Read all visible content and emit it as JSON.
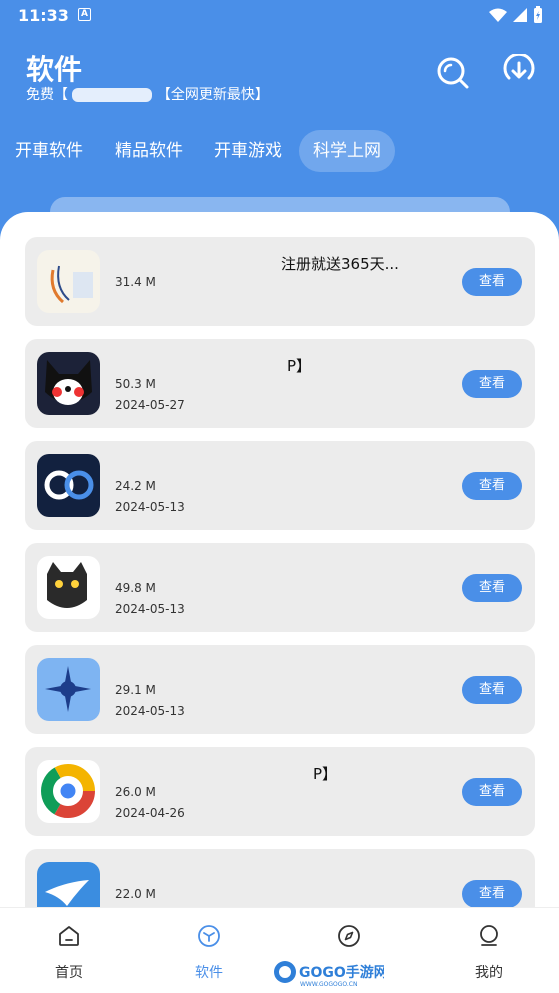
{
  "status": {
    "time": "11:33"
  },
  "header": {
    "title": "软件",
    "subtitle_prefix": "免费【",
    "subtitle_suffix": "【全网更新最快】"
  },
  "tabs": [
    {
      "label": "开車软件",
      "active": false
    },
    {
      "label": "精品软件",
      "active": false
    },
    {
      "label": "开車游戏",
      "active": false
    },
    {
      "label": "科学上网",
      "active": true
    }
  ],
  "view_label": "查看",
  "apps": [
    {
      "name": "注册就送365天...",
      "size": "31.4 M",
      "date": ""
    },
    {
      "name": "P】",
      "size": "50.3 M",
      "date": "2024-05-27"
    },
    {
      "name": "",
      "size": "24.2 M",
      "date": "2024-05-13"
    },
    {
      "name": "",
      "size": "49.8 M",
      "date": "2024-05-13"
    },
    {
      "name": "",
      "size": "29.1 M",
      "date": "2024-05-13"
    },
    {
      "name": "P】",
      "size": "26.0 M",
      "date": "2024-04-26"
    },
    {
      "name": "",
      "size": "22.0 M",
      "date": ""
    }
  ],
  "nav": [
    {
      "label": "首页",
      "icon": "home-icon",
      "active": false
    },
    {
      "label": "软件",
      "icon": "cube-icon",
      "active": true
    },
    {
      "label": "",
      "icon": "compass-icon",
      "active": false
    },
    {
      "label": "我的",
      "icon": "user-icon",
      "active": false
    }
  ],
  "watermark": {
    "text": "GOGO手游网",
    "sub": "WWW.GOGOGO.CN"
  },
  "colors": {
    "accent": "#4a8fe8",
    "card": "#ececec"
  }
}
